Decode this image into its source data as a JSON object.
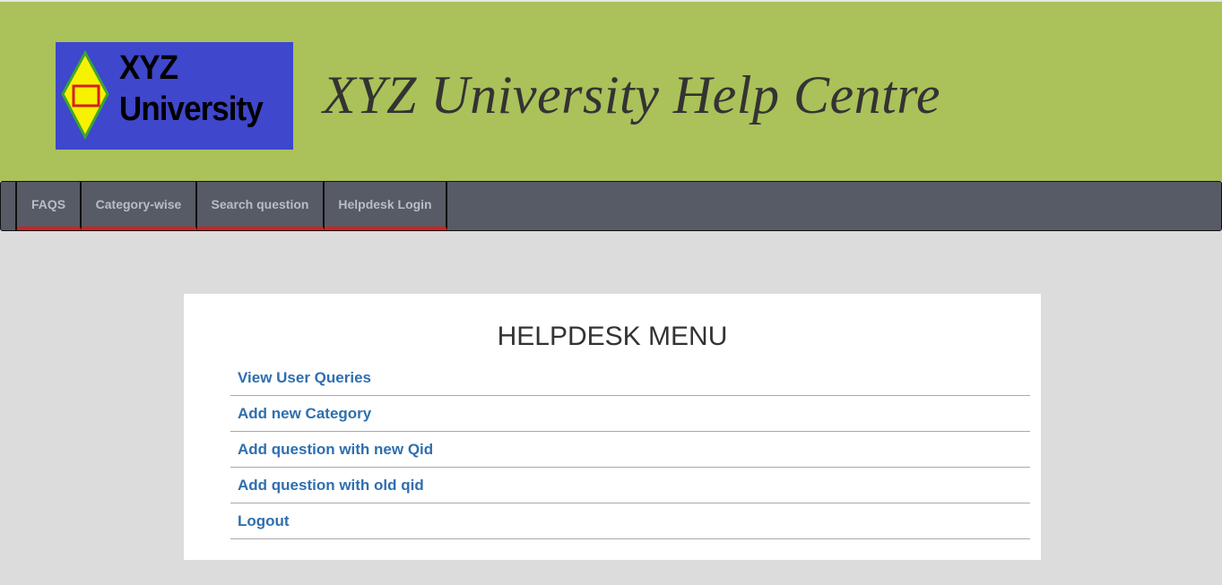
{
  "header": {
    "logo_text_line1": "XYZ",
    "logo_text_line2": "University",
    "site_title": "XYZ University Help Centre"
  },
  "nav": {
    "items": [
      {
        "label": "FAQS"
      },
      {
        "label": "Category-wise"
      },
      {
        "label": "Search question"
      },
      {
        "label": "Helpdesk Login"
      }
    ]
  },
  "main": {
    "title": "HELPDESK MENU",
    "menu": [
      {
        "label": "View User Queries"
      },
      {
        "label": "Add new Category"
      },
      {
        "label": "Add question with new Qid"
      },
      {
        "label": "Add question with old qid"
      },
      {
        "label": "Logout"
      }
    ]
  },
  "colors": {
    "header_bg": "#abc15a",
    "logo_bg": "#3f47cc",
    "nav_bg": "#575b65",
    "nav_underline": "#d42020",
    "link": "#2f6fae",
    "page_bg": "#dcdcdc"
  }
}
